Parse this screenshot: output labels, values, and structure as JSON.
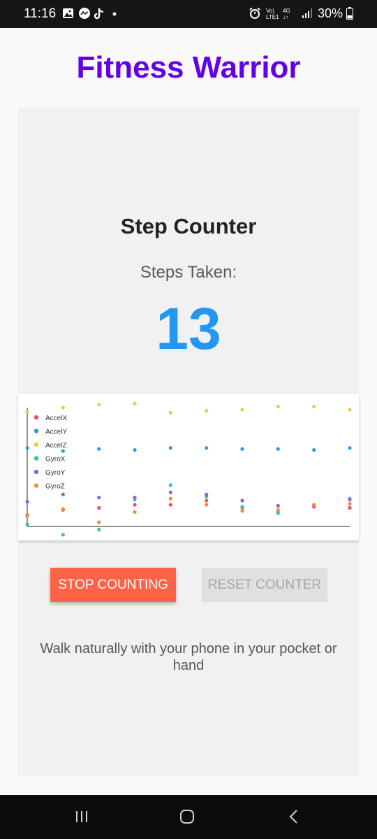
{
  "status_bar": {
    "time": "11:16",
    "battery": "30%",
    "network_label": "Vo) 4G LTE1",
    "left_icons": [
      "gallery-icon",
      "messenger-icon",
      "tiktok-icon",
      "dot-icon"
    ],
    "right_icons": [
      "alarm-icon",
      "volte-icon",
      "signal-icon",
      "battery-icon"
    ]
  },
  "app": {
    "title": "Fitness Warrior"
  },
  "counter": {
    "title": "Step Counter",
    "steps_label": "Steps Taken:",
    "steps_value": "13"
  },
  "chart_data": {
    "type": "scatter",
    "title": "",
    "xlabel": "",
    "ylabel": "",
    "grid": false,
    "legend_position": "top-left",
    "x": [
      0,
      1,
      2,
      3,
      4,
      5,
      6,
      7,
      8,
      9
    ],
    "ylim": [
      -1,
      10.5
    ],
    "series": [
      {
        "name": "AccelX",
        "color": "#e8536b",
        "values": [
          0.1,
          0.6,
          0.8,
          1.1,
          1.1,
          1.5,
          0.8,
          0.4,
          0.9,
          0.8
        ]
      },
      {
        "name": "AccelY",
        "color": "#2e9be0",
        "values": [
          6.6,
          6.3,
          6.5,
          6.4,
          6.6,
          6.6,
          6.5,
          6.5,
          6.4,
          6.6
        ]
      },
      {
        "name": "AccelZ",
        "color": "#f5c842",
        "values": [
          10.1,
          10.5,
          10.8,
          10.9,
          10.0,
          10.2,
          10.3,
          10.6,
          10.6,
          10.3
        ]
      },
      {
        "name": "GyroX",
        "color": "#3bbdb4",
        "values": [
          -0.8,
          -1.8,
          -1.3,
          1.6,
          3.0,
          1.9,
          0.9,
          0.3,
          1.1,
          1.7
        ]
      },
      {
        "name": "GyroY",
        "color": "#9c5bdc",
        "values": [
          1.4,
          2.1,
          1.8,
          1.8,
          2.3,
          2.1,
          1.5,
          1.0,
          1.1,
          1.6
        ]
      },
      {
        "name": "GyroZ",
        "color": "#f28c38",
        "values": [
          0.0,
          0.7,
          -0.6,
          0.4,
          1.7,
          1.1,
          0.5,
          0.6,
          1.1,
          1.2
        ]
      }
    ]
  },
  "buttons": {
    "stop_label": "Stop Counting",
    "reset_label": "Reset Counter"
  },
  "hint": "Walk naturally with your phone in your pocket or hand",
  "nav": {
    "recent": "recent-apps-icon",
    "home": "home-icon",
    "back": "back-icon"
  }
}
